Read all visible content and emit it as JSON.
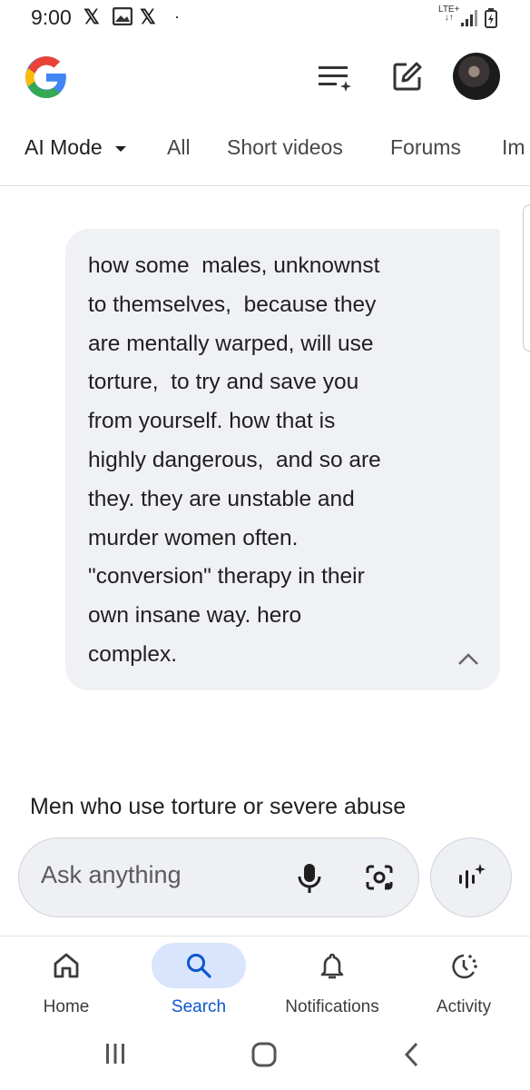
{
  "status_bar": {
    "time": "9:00",
    "network": "LTE+"
  },
  "header": {
    "logo": "google-g-logo",
    "icons": [
      "history-list-icon",
      "new-chat-icon",
      "avatar"
    ]
  },
  "tabs": [
    {
      "label": "AI Mode",
      "active": true
    },
    {
      "label": "All"
    },
    {
      "label": "Short videos"
    },
    {
      "label": "Forums"
    },
    {
      "label": "Im"
    }
  ],
  "query": {
    "text": "how some  males, unknownst\nto themselves,  because they\nare mentally warped, will use\ntorture,  to try and save you\nfrom yourself. how that is\nhighly dangerous,  and so are\nthey. they are unstable and\nmurder women often.\n\"conversion\" therapy in their\nown insane way. hero\ncomplex."
  },
  "answer": {
    "start": "Men who use torture or severe abuse"
  },
  "ask_bar": {
    "placeholder": "Ask anything"
  },
  "bottom_nav": [
    {
      "label": "Home",
      "icon": "home-icon"
    },
    {
      "label": "Search",
      "icon": "search-icon",
      "active": true
    },
    {
      "label": "Notifications",
      "icon": "bell-icon"
    },
    {
      "label": "Activity",
      "icon": "activity-icon"
    }
  ],
  "colors": {
    "accent": "#0b57d0",
    "pill": "#d8e5fd",
    "bubble": "#f0f1f5"
  }
}
